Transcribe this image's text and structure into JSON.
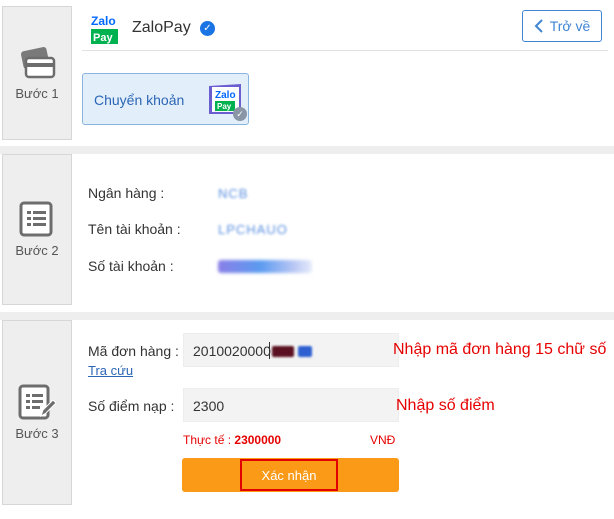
{
  "header": {
    "provider_logo_top": "Zalo",
    "provider_logo_bottom": "Pay",
    "provider_name": "ZaloPay",
    "back_label": "Trở về"
  },
  "steps": [
    {
      "label": "Bước 1",
      "icon": "credit-card-icon"
    },
    {
      "label": "Bước 2",
      "icon": "form-list-icon"
    },
    {
      "label": "Bước 3",
      "icon": "form-edit-icon"
    }
  ],
  "step1": {
    "method_label": "Chuyển khoản",
    "method_icon_top": "Zalo",
    "method_icon_bottom": "Pay"
  },
  "step2": {
    "bank_label": "Ngân hàng :",
    "bank_value": "NCB",
    "account_name_label": "Tên tài khoản :",
    "account_name_value": "LPCHAUO",
    "account_number_label": "Số tài khoản :"
  },
  "step3": {
    "order_label": "Mã đơn hàng :",
    "order_value": "2010020000",
    "order_note": "Nhập mã đơn hàng 15 chữ số",
    "lookup_label": "Tra cứu",
    "points_label": "Số điểm nạp :",
    "points_value": "2300",
    "points_note": "Nhập số điểm",
    "actual_label": "Thực tế : ",
    "actual_value": "2300000",
    "currency": "VNĐ",
    "confirm_label": "Xác nhận"
  },
  "colors": {
    "accent_blue": "#3f85d4",
    "confirm_orange": "#fa9a17",
    "alert_red": "#e60000"
  }
}
